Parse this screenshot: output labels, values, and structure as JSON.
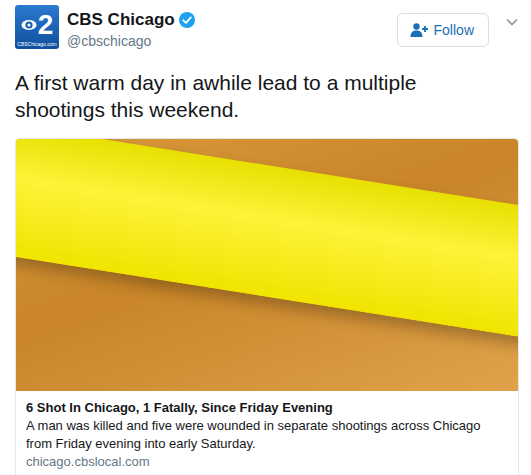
{
  "account": {
    "logo_text": "2",
    "logo_caption": "CBSChicago.com",
    "name": "CBS Chicago",
    "verified": true,
    "handle": "@cbschicago"
  },
  "follow_button": {
    "label": "Follow"
  },
  "tweet": {
    "text": "A first warm day in awhile lead to a multiple shootings this weekend."
  },
  "card": {
    "title": "6 Shot In Chicago, 1 Fatally, Since Friday Evening",
    "description": "A man was killed and five were wounded in separate shootings across Chicago from Friday evening into early Saturday.",
    "domain": "chicago.cbslocal.com"
  }
}
